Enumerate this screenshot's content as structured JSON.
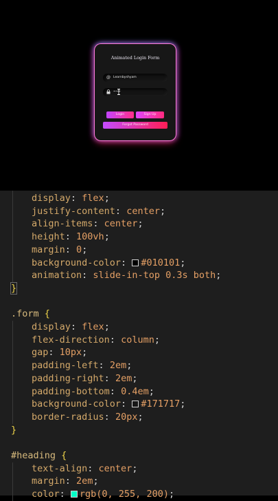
{
  "preview": {
    "title": "Animated Login Form",
    "username_icon": "@",
    "username_value": "Learnbyshyam",
    "password_icon": "lock-icon",
    "password_value": "••••",
    "login_label": "Login",
    "signup_label": "Sign Up",
    "forgot_label": "Forgot Password",
    "colors": {
      "card_bg": "#171717",
      "page_bg": "#000000",
      "button_pink": "#ff2f8a",
      "button_purple": "#c445ff"
    }
  },
  "code": {
    "lines": [
      {
        "prop": "display",
        "value": "flex"
      },
      {
        "prop": "justify-content",
        "value": "center"
      },
      {
        "prop": "align-items",
        "value": "center"
      },
      {
        "prop": "height",
        "value": "100vh"
      },
      {
        "prop": "margin",
        "value": "0"
      },
      {
        "prop": "background-color",
        "value": "#010101",
        "swatch": "#010101"
      },
      {
        "prop": "animation",
        "value": "slide-in-top 0.3s both"
      },
      {
        "close": "}"
      },
      {
        "blank": ""
      },
      {
        "selector": ".form {"
      },
      {
        "prop": "display",
        "value": "flex"
      },
      {
        "prop": "flex-direction",
        "value": "column"
      },
      {
        "prop": "gap",
        "value": "10px"
      },
      {
        "prop": "padding-left",
        "value": "2em"
      },
      {
        "prop": "padding-right",
        "value": "2em"
      },
      {
        "prop": "padding-bottom",
        "value": "0.4em"
      },
      {
        "prop": "background-color",
        "value": "#171717",
        "swatch": "#171717"
      },
      {
        "prop": "border-radius",
        "value": "20px"
      },
      {
        "close": "}"
      },
      {
        "blank": ""
      },
      {
        "selector": "#heading {"
      },
      {
        "prop": "text-align",
        "value": "center"
      },
      {
        "prop": "margin",
        "value": "2em"
      },
      {
        "prop": "color",
        "value": "rgb(0, 255, 200)",
        "swatch": "#00ffc8"
      }
    ]
  }
}
